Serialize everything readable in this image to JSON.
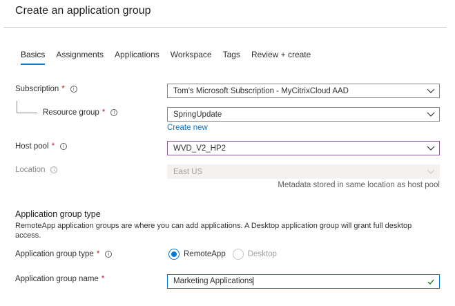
{
  "page": {
    "title": "Create an application group"
  },
  "tabs": [
    {
      "label": "Basics",
      "active": true
    },
    {
      "label": "Assignments",
      "active": false
    },
    {
      "label": "Applications",
      "active": false
    },
    {
      "label": "Workspace",
      "active": false
    },
    {
      "label": "Tags",
      "active": false
    },
    {
      "label": "Review + create",
      "active": false
    }
  ],
  "form": {
    "subscription": {
      "label": "Subscription",
      "required": "*",
      "info": "i",
      "value": "Tom's Microsoft Subscription - MyCitrixCloud AAD"
    },
    "resource_group": {
      "label": "Resource group",
      "required": "*",
      "info": "i",
      "value": "SpringUpdate",
      "create_new": "Create new"
    },
    "host_pool": {
      "label": "Host pool",
      "required": "*",
      "info": "i",
      "value": "WVD_V2_HP2"
    },
    "location": {
      "label": "Location",
      "info": "i",
      "value": "East US",
      "hint": "Metadata stored in same location as host pool"
    },
    "app_group_section": {
      "title": "Application group type",
      "description": "RemoteApp application groups are where you can add applications. A Desktop application group will grant full desktop access."
    },
    "app_group_type": {
      "label": "Application group type",
      "required": "*",
      "info": "i",
      "options": [
        "RemoteApp",
        "Desktop"
      ],
      "selected": "RemoteApp"
    },
    "app_group_name": {
      "label": "Application group name",
      "required": "*",
      "value": "Marketing Applications"
    }
  },
  "colors": {
    "accent": "#0078d4",
    "required": "#a4262c",
    "focus_border": "#8e5a9e"
  }
}
